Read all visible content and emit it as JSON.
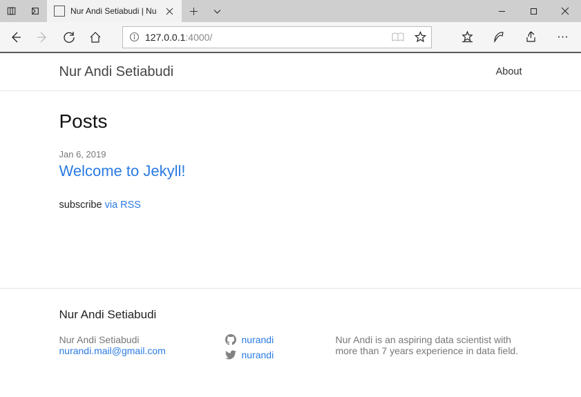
{
  "tab": {
    "title": "Nur Andi Setiabudi | Nu"
  },
  "address": {
    "host": "127.0.0.1",
    "port_path": ":4000/"
  },
  "site": {
    "title": "Nur Andi Setiabudi",
    "nav_about": "About"
  },
  "posts": {
    "heading": "Posts",
    "items": [
      {
        "date": "Jan 6, 2019",
        "title": "Welcome to Jekyll!"
      }
    ],
    "subscribe_prefix": "subscribe ",
    "subscribe_link": "via RSS"
  },
  "footer": {
    "title": "Nur Andi Setiabudi",
    "name": "Nur Andi Setiabudi",
    "email": "nurandi.mail@gmail.com",
    "github": "nurandi",
    "twitter": "nurandi",
    "bio": "Nur Andi is an aspiring data scientist with more than 7 years experience in data field."
  }
}
